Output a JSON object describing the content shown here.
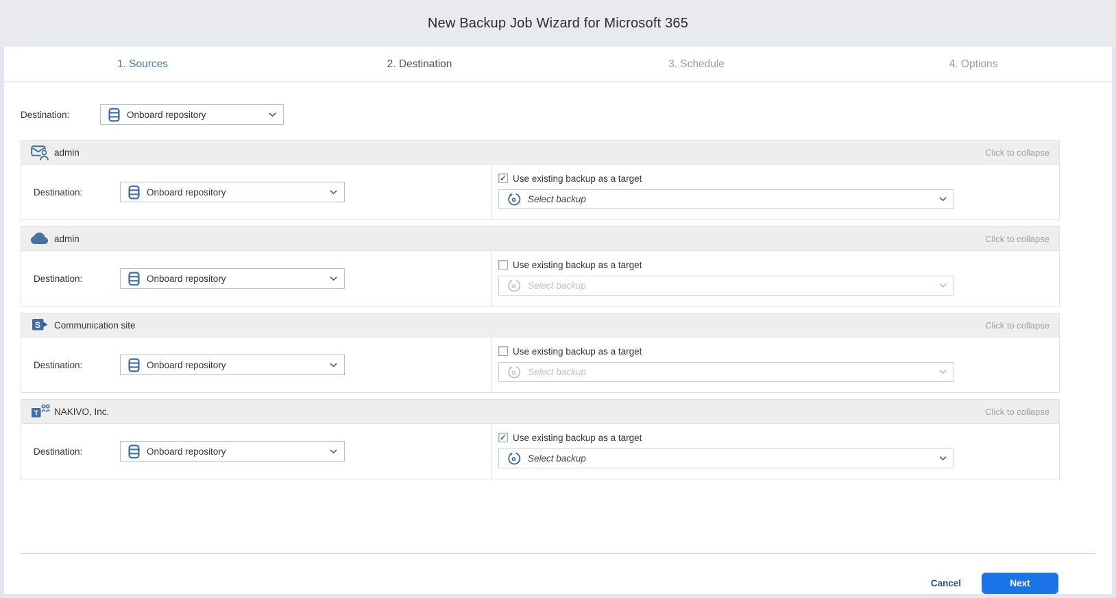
{
  "window": {
    "title": "New Backup Job Wizard for Microsoft 365"
  },
  "steps": [
    {
      "label": "1. Sources"
    },
    {
      "label": "2. Destination"
    },
    {
      "label": "3. Schedule"
    },
    {
      "label": "4. Options"
    }
  ],
  "global_destination": {
    "label": "Destination:",
    "value": "Onboard repository",
    "icon": "repository-icon"
  },
  "sections": [
    {
      "name": "admin",
      "icon": "exchange-mailbox-icon",
      "collapse_hint": "Click to collapse",
      "destination": {
        "label": "Destination:",
        "value": "Onboard repository"
      },
      "use_existing": {
        "label": "Use existing backup as a target",
        "checked": true
      },
      "select_backup": {
        "placeholder": "Select backup",
        "disabled": false
      }
    },
    {
      "name": "admin",
      "icon": "onedrive-cloud-icon",
      "collapse_hint": "Click to collapse",
      "destination": {
        "label": "Destination:",
        "value": "Onboard repository"
      },
      "use_existing": {
        "label": "Use existing backup as a target",
        "checked": false
      },
      "select_backup": {
        "placeholder": "Select backup",
        "disabled": true
      }
    },
    {
      "name": "Communication site",
      "icon": "sharepoint-icon",
      "collapse_hint": "Click to collapse",
      "destination": {
        "label": "Destination:",
        "value": "Onboard repository"
      },
      "use_existing": {
        "label": "Use existing backup as a target",
        "checked": false
      },
      "select_backup": {
        "placeholder": "Select backup",
        "disabled": true
      }
    },
    {
      "name": "NAKIVO, Inc.",
      "icon": "teams-icon",
      "collapse_hint": "Click to collapse",
      "destination": {
        "label": "Destination:",
        "value": "Onboard repository"
      },
      "use_existing": {
        "label": "Use existing backup as a target",
        "checked": true
      },
      "select_backup": {
        "placeholder": "Select backup",
        "disabled": false
      }
    }
  ],
  "footer": {
    "cancel_label": "Cancel",
    "next_label": "Next"
  },
  "colors": {
    "accent_blue": "#1a73e8",
    "icon_blue": "#3a6ea5",
    "step_done": "#4a7cae",
    "titlebar_bg": "#e9eaee",
    "section_header_bg": "#eeeeef"
  }
}
